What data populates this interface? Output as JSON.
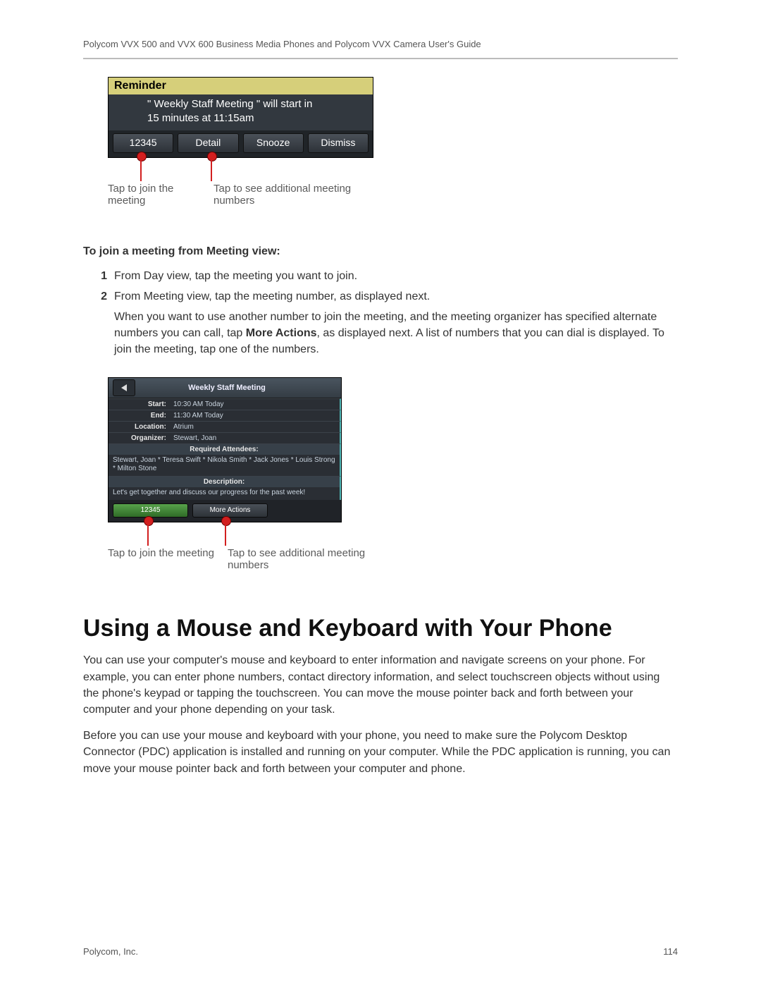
{
  "header": "Polycom VVX 500 and VVX 600 Business Media Phones and Polycom VVX Camera User's Guide",
  "reminder": {
    "title": "Reminder",
    "body_line1": "\" Weekly Staff Meeting \" will start in",
    "body_line2": "15 minutes at 11:15am",
    "buttons": {
      "b1": "12345",
      "b2": "Detail",
      "b3": "Snooze",
      "b4": "Dismiss"
    }
  },
  "annotation": {
    "join": "Tap to join the meeting",
    "more": "Tap to see additional meeting numbers"
  },
  "instructions": {
    "heading": "To join a meeting from Meeting view:",
    "step1": "From Day view, tap the meeting you want to join.",
    "step2": "From Meeting view, tap the meeting number, as displayed next.",
    "note_pre": "When you want to use another number to join the meeting, and the meeting organizer has specified alternate numbers you can call, tap ",
    "note_bold": "More Actions",
    "note_post": ", as displayed next. A list of numbers that you can dial is displayed. To join the meeting, tap one of the numbers."
  },
  "meeting": {
    "title": "Weekly Staff Meeting",
    "labels": {
      "start": "Start:",
      "end": "End:",
      "location": "Location:",
      "organizer": "Organizer:"
    },
    "values": {
      "start": "10:30 AM Today",
      "end": "11:30 AM Today",
      "location": "Atrium",
      "organizer": "Stewart, Joan"
    },
    "attendees_hdr": "Required Attendees:",
    "attendees": "Stewart, Joan * Teresa Swift * Nikola Smith * Jack Jones * Louis Strong * Milton Stone",
    "description_hdr": "Description:",
    "description": "Let's get together and discuss our progress for the past week!",
    "buttons": {
      "num": "12345",
      "more": "More Actions"
    }
  },
  "section_title": "Using a Mouse and Keyboard with Your Phone",
  "para1": "You can use your computer's mouse and keyboard to enter information and navigate screens on your phone. For example, you can enter phone numbers, contact directory information, and select touchscreen objects without using the phone's keypad or tapping the touchscreen. You can move the mouse pointer back and forth between your computer and your phone depending on your task.",
  "para2": "Before you can use your mouse and keyboard with your phone, you need to make sure the Polycom Desktop Connector (PDC) application is installed and running on your computer. While the PDC application is running, you can move your mouse pointer back and forth between your computer and phone.",
  "footer": {
    "company": "Polycom, Inc.",
    "page": "114"
  }
}
